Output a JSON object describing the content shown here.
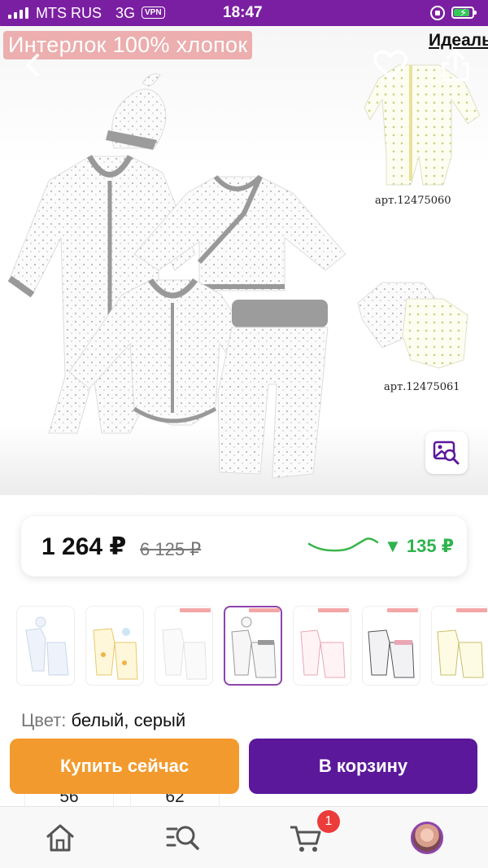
{
  "status_bar": {
    "carrier": "MTS RUS",
    "network": "3G",
    "vpn": "VPN",
    "time": "18:47"
  },
  "hero": {
    "promo_label": "Интерлок 100% хлопок",
    "next_label": "Идеаль",
    "article_1": "арт.12475060",
    "article_2": "арт.12475061",
    "icons": [
      "back-arrow",
      "heart",
      "share",
      "image-search"
    ]
  },
  "price": {
    "current": "1 264 ₽",
    "old": "6 125 ₽",
    "change": "▼ 135 ₽",
    "change_color": "#2fb34f"
  },
  "thumbnails": {
    "selected_index": 3,
    "count": 7
  },
  "color": {
    "label": "Цвет:",
    "value": "белый, серый"
  },
  "actions": {
    "buy_now": "Купить сейчас",
    "add_to_cart": "В корзину",
    "buy_color": "#f29a2e",
    "cart_color": "#5b189a"
  },
  "sizes": [
    "56",
    "62"
  ],
  "tabbar": {
    "cart_badge": "1",
    "items": [
      "home",
      "catalog-search",
      "cart",
      "profile"
    ]
  }
}
